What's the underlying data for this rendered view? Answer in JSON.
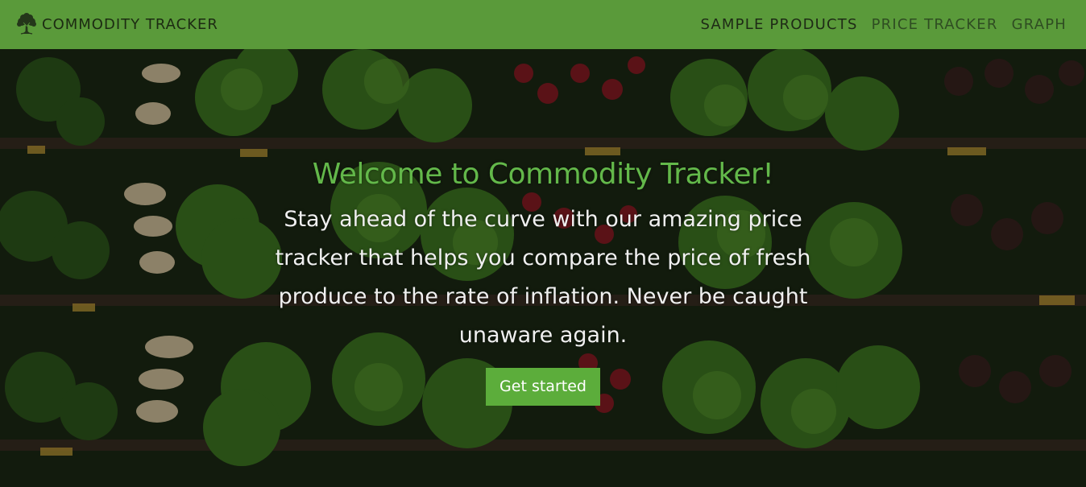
{
  "nav": {
    "brand_title": "COMMODITY TRACKER",
    "brand_icon": "tree-icon",
    "links": [
      {
        "label": "SAMPLE PRODUCTS",
        "active": true
      },
      {
        "label": "PRICE TRACKER",
        "active": false
      },
      {
        "label": "GRAPH",
        "active": false
      }
    ]
  },
  "hero": {
    "title": "Welcome to Commodity Tracker!",
    "subtitle": "Stay ahead of the curve with our amazing price tracker that helps you compare the price of fresh produce to the rate of inflation. Never be caught unaware again.",
    "button_label": "Get started",
    "background": "produce-shelves-image"
  },
  "colors": {
    "navbar": "#5a9a3a",
    "title": "#63b84a",
    "button": "#5cad3b",
    "nav_text": "#1e2a16"
  }
}
